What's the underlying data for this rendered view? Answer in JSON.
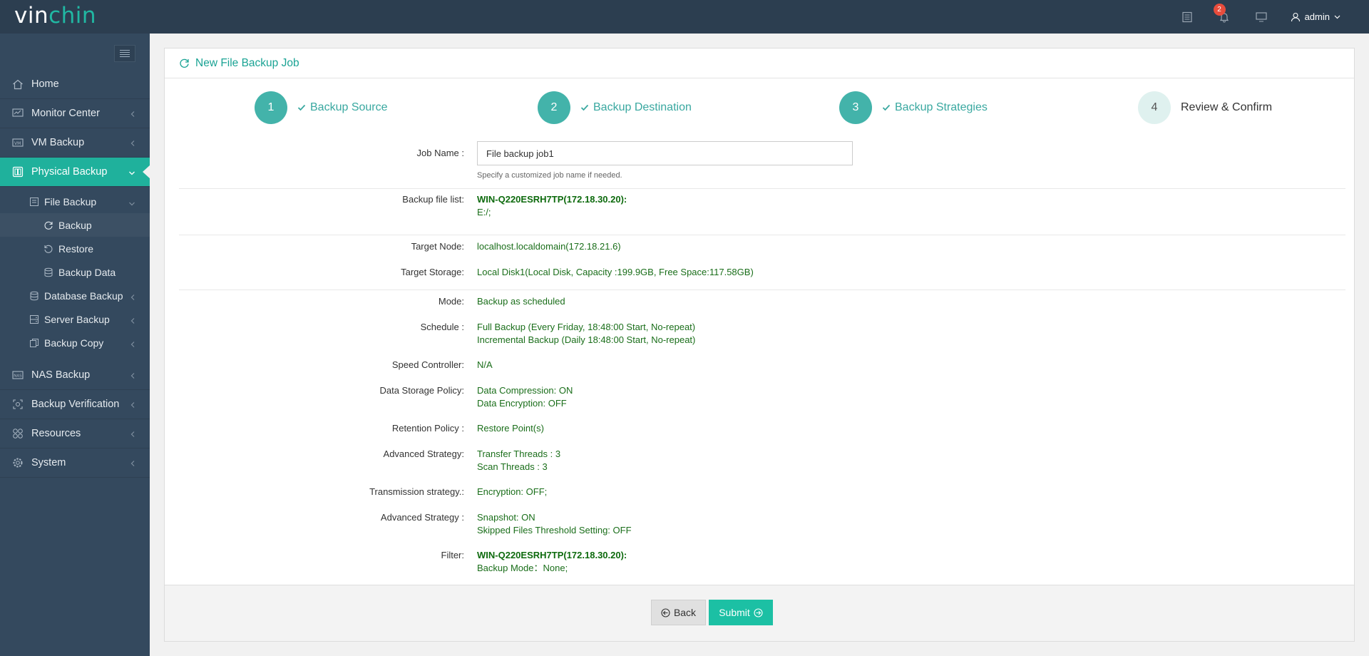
{
  "header": {
    "logo_main": "vin",
    "logo_accent": "chin",
    "notification_count": "2",
    "user": "admin"
  },
  "sidebar": {
    "items": [
      {
        "label": "Home",
        "icon": "home-icon"
      },
      {
        "label": "Monitor Center",
        "icon": "monitor-icon"
      },
      {
        "label": "VM Backup",
        "icon": "vm-icon"
      },
      {
        "label": "Physical Backup",
        "icon": "physical-server-icon"
      },
      {
        "label": "NAS Backup",
        "icon": "nas-icon"
      },
      {
        "label": "Backup Verification",
        "icon": "verification-icon"
      },
      {
        "label": "Resources",
        "icon": "resources-icon"
      },
      {
        "label": "System",
        "icon": "gear-icon"
      }
    ],
    "sub": {
      "file_backup": "File Backup",
      "backup": "Backup",
      "restore": "Restore",
      "backup_data": "Backup Data",
      "database_backup": "Database Backup",
      "server_backup": "Server Backup",
      "backup_copy": "Backup Copy"
    }
  },
  "panel": {
    "title": "New File Backup Job"
  },
  "steps": [
    {
      "num": "1",
      "label": "Backup Source"
    },
    {
      "num": "2",
      "label": "Backup Destination"
    },
    {
      "num": "3",
      "label": "Backup Strategies"
    },
    {
      "num": "4",
      "label": "Review & Confirm"
    }
  ],
  "form": {
    "job_name_label": "Job Name :",
    "job_name_value": "File backup job1",
    "job_name_hint": "Specify a customized job name if needed.",
    "backup_file_list_label": "Backup file list:",
    "backup_file_list_host": "WIN-Q220ESRH7TP(172.18.30.20):",
    "backup_file_list_path": "E:/;",
    "target_node_label": "Target Node:",
    "target_node_value": "localhost.localdomain(172.18.21.6)",
    "target_storage_label": "Target Storage:",
    "target_storage_value": "Local Disk1(Local Disk, Capacity :199.9GB, Free Space:117.58GB)",
    "mode_label": "Mode:",
    "mode_value": "Backup as scheduled",
    "schedule_label": "Schedule :",
    "schedule_line1": "Full Backup (Every Friday, 18:48:00 Start, No-repeat)",
    "schedule_line2": "Incremental Backup (Daily 18:48:00 Start, No-repeat)",
    "speed_label": "Speed Controller:",
    "speed_value": "N/A",
    "storage_policy_label": "Data Storage Policy:",
    "storage_policy_line1": "Data Compression: ON",
    "storage_policy_line2": "Data Encryption: OFF",
    "retention_label": "Retention Policy :",
    "retention_value": "Restore Point(s)",
    "advanced1_label": "Advanced Strategy:",
    "advanced1_line1": "Transfer Threads : 3",
    "advanced1_line2": "Scan Threads : 3",
    "transmission_label": "Transmission strategy.:",
    "transmission_value": "Encryption: OFF;",
    "advanced2_label": "Advanced Strategy :",
    "advanced2_line1": "Snapshot: ON",
    "advanced2_line2": "Skipped Files Threshold Setting: OFF",
    "filter_label": "Filter:",
    "filter_host": "WIN-Q220ESRH7TP(172.18.30.20):",
    "filter_mode": "Backup Mode：None;"
  },
  "footer": {
    "back_label": "Back",
    "submit_label": "Submit"
  }
}
